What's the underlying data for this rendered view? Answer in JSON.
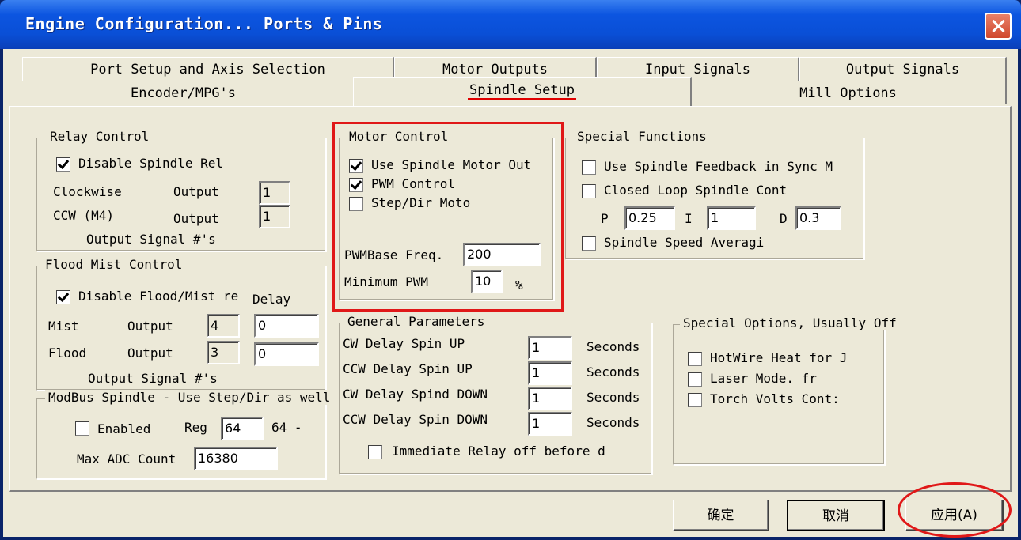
{
  "window": {
    "title": "Engine Configuration... Ports & Pins"
  },
  "tabs_top": [
    "Port Setup and Axis Selection",
    "Motor Outputs",
    "Input Signals",
    "Output Signals"
  ],
  "tabs_bottom": [
    "Encoder/MPG's",
    "Spindle Setup",
    "Mill Options"
  ],
  "active_tab": "Spindle Setup",
  "relay": {
    "title": "Relay Control",
    "disable_label": "Disable Spindle Rel",
    "disable_checked": true,
    "cw_label": "Clockwise",
    "ccw_label": "CCW (M4)",
    "output_label": "Output",
    "cw_output": "1",
    "ccw_output": "1",
    "footer": "Output Signal #'s"
  },
  "flood": {
    "title": "Flood Mist Control",
    "disable_label": "Disable Flood/Mist re",
    "delay_label": "Delay",
    "disable_checked": true,
    "mist_label": "Mist",
    "flood_label": "Flood",
    "output_label": "Output",
    "mist_output": "4",
    "flood_output": "3",
    "mist_delay": "0",
    "flood_delay": "0",
    "footer": "Output Signal #'s"
  },
  "modbus": {
    "title": "ModBus Spindle - Use Step/Dir as well",
    "enabled_label": "Enabled",
    "enabled_checked": false,
    "reg_label": "Reg",
    "reg_value": "64",
    "reg_suffix": "64 -",
    "max_adc_label": "Max ADC Count",
    "max_adc_value": "16380"
  },
  "motor": {
    "title": "Motor Control",
    "use_motor_label": "Use Spindle Motor Out",
    "use_motor_checked": true,
    "pwm_label": "PWM Control",
    "pwm_checked": true,
    "stepdir_label": "Step/Dir Moto",
    "stepdir_checked": false,
    "pwm_base_label": "PWMBase Freq.",
    "pwm_base_value": "200",
    "min_pwm_label": "Minimum PWM",
    "min_pwm_value": "10",
    "percent": "%"
  },
  "special": {
    "title": "Special Functions",
    "feedback_label": "Use Spindle Feedback in Sync M",
    "feedback_checked": false,
    "closed_loop_label": "Closed Loop Spindle Cont",
    "closed_loop_checked": false,
    "p_label": "P",
    "p_value": "0.25",
    "i_label": "I",
    "i_value": "1",
    "d_label": "D",
    "d_value": "0.3",
    "avg_label": "Spindle Speed Averagi",
    "avg_checked": false
  },
  "general": {
    "title": "General Parameters",
    "rows": [
      {
        "label": "CW Delay Spin UP",
        "value": "1",
        "unit": "Seconds"
      },
      {
        "label": "CCW Delay Spin UP",
        "value": "1",
        "unit": "Seconds"
      },
      {
        "label": "CW Delay Spind DOWN",
        "value": "1",
        "unit": "Seconds"
      },
      {
        "label": "CCW Delay Spin DOWN",
        "value": "1",
        "unit": "Seconds"
      }
    ],
    "immediate_label": "Immediate Relay off before d",
    "immediate_checked": false
  },
  "options": {
    "title": "Special Options, Usually Off",
    "hotwire_label": "HotWire Heat for J",
    "laser_label": "Laser Mode. fr",
    "torch_label": "Torch Volts Cont:"
  },
  "buttons": {
    "ok": "确定",
    "cancel": "取消",
    "apply": "应用(A)"
  },
  "colors": {
    "highlight": "#e01818",
    "titlebar": "#0a4fd6",
    "dialog_bg": "#ECE9D8"
  }
}
